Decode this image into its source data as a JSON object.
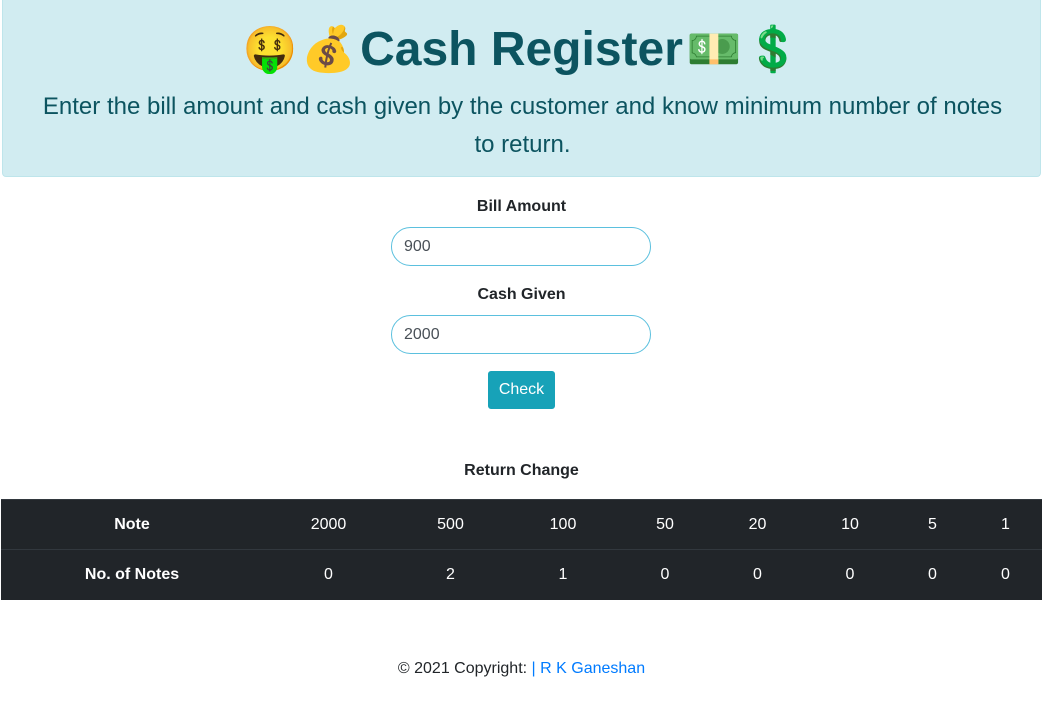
{
  "header": {
    "title": "Cash Register",
    "emoji_left": [
      "🤑",
      "💰"
    ],
    "emoji_right": [
      "💵",
      "💲"
    ],
    "subtitle": "Enter the bill amount and cash given by the customer and know minimum number of notes to return."
  },
  "form": {
    "bill_label": "Bill Amount",
    "bill_value": "900",
    "cash_label": "Cash Given",
    "cash_value": "2000",
    "check_label": "Check"
  },
  "result": {
    "heading": "Return Change",
    "row1_label": "Note",
    "row2_label": "No. of Notes",
    "notes": [
      "2000",
      "500",
      "100",
      "50",
      "20",
      "10",
      "5",
      "1"
    ],
    "counts": [
      "0",
      "2",
      "1",
      "0",
      "0",
      "0",
      "0",
      "0"
    ]
  },
  "footer": {
    "prefix": "© 2021 Copyright: ",
    "author": "| R K Ganeshan"
  },
  "colors": {
    "header_bg": "#d1ecf1",
    "header_text": "#0c5460",
    "button": "#17a2b8",
    "table_bg": "#212529",
    "link": "#007bff"
  }
}
